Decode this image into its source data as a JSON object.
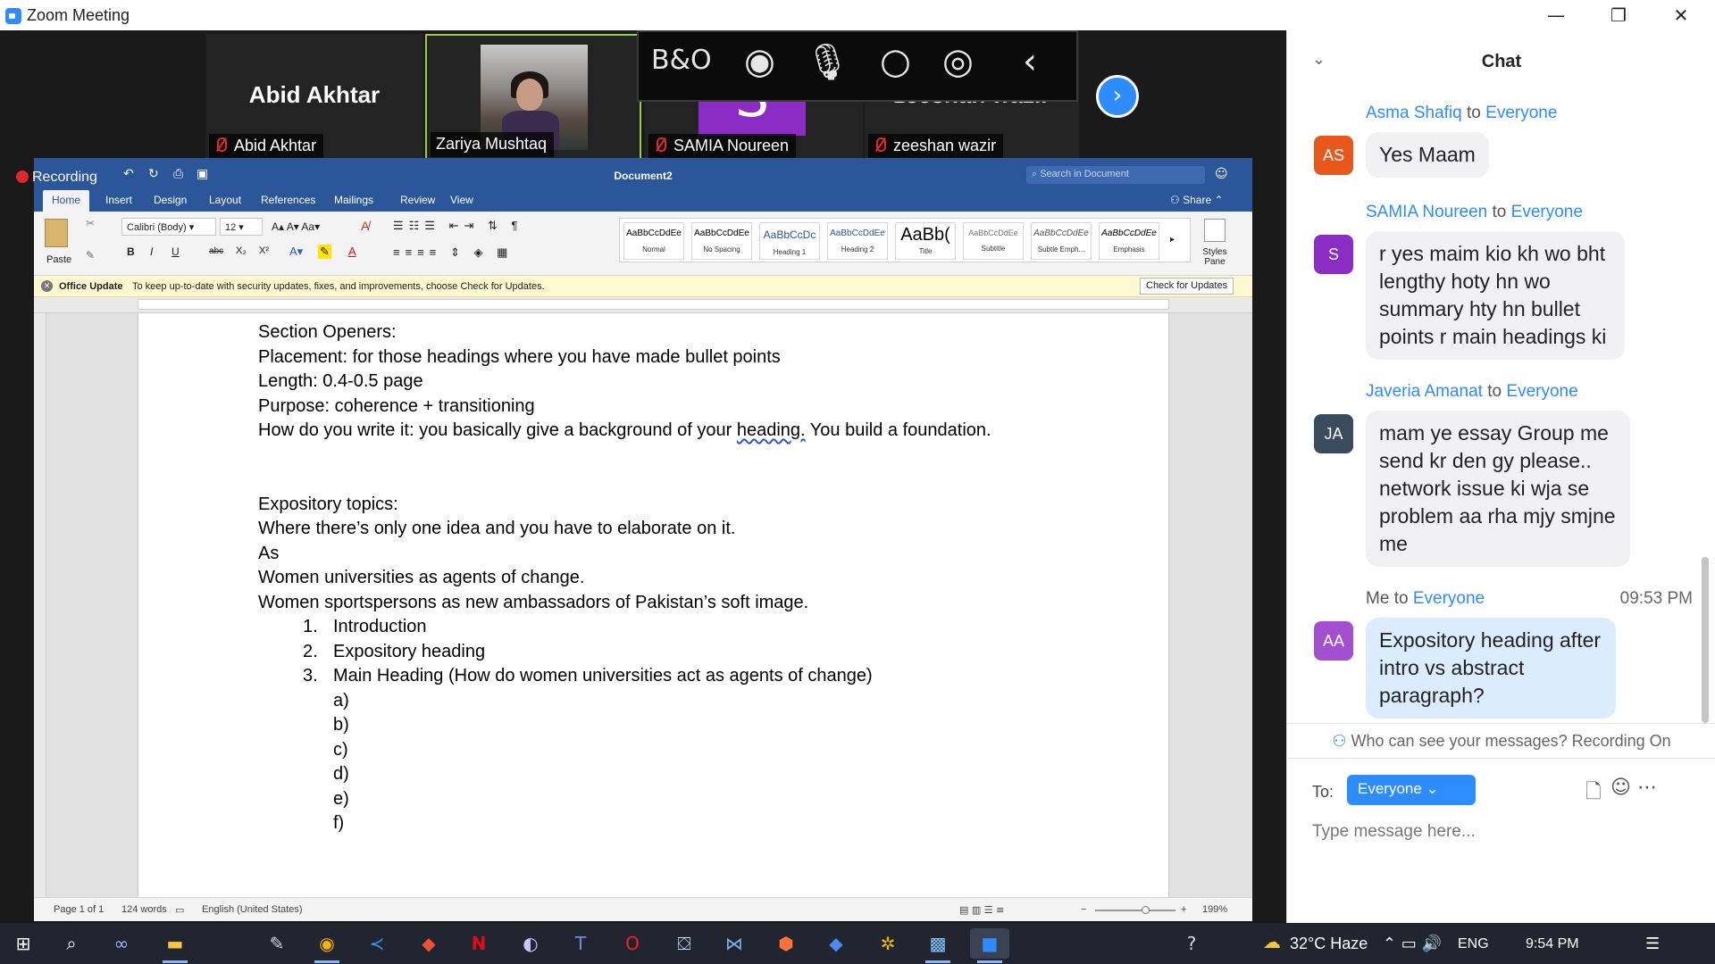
{
  "window": {
    "title": "Zoom Meeting",
    "minimize_icon": "—",
    "restore_icon": "❐",
    "close_icon": "✕"
  },
  "gallery": [
    {
      "display_name": "Abid Akhtar",
      "nameplate": "Abid Akhtar",
      "muted": true
    },
    {
      "nameplate": "Zariya Mushtaq",
      "video": true,
      "active_speaker": true
    },
    {
      "avatar_letter": "S",
      "nameplate": "SAMIA Noureen",
      "muted": true
    },
    {
      "display_name": "zeeshan wazir",
      "nameplate": "zeeshan wazir",
      "muted": true
    }
  ],
  "overlay": {
    "logo": "B&O",
    "icons": [
      "record-icon",
      "mic-icon",
      "circle-icon",
      "mic-active-icon",
      "back-icon"
    ]
  },
  "recording": {
    "label": "Recording"
  },
  "word": {
    "doc_title": "Document2",
    "search_placeholder": "Search in Document",
    "tabs": [
      "Home",
      "Insert",
      "Design",
      "Layout",
      "References",
      "Mailings",
      "Review",
      "View"
    ],
    "active_tab": "Home",
    "share_label": "Share",
    "ribbon": {
      "paste_label": "Paste",
      "font_name": "Calibri (Body)",
      "font_size": "12",
      "bold": "B",
      "italic": "I",
      "underline": "U",
      "strike": "abc",
      "subscript": "X₂",
      "superscript": "X²",
      "styles": [
        {
          "preview": "AaBbCcDdEe",
          "label": "Normal"
        },
        {
          "preview": "AaBbCcDdEe",
          "label": "No Spacing"
        },
        {
          "preview": "AaBbCcDc",
          "label": "Heading 1"
        },
        {
          "preview": "AaBbCcDdEe",
          "label": "Heading 2"
        },
        {
          "preview": "AaBb(",
          "label": "Title"
        },
        {
          "preview": "AaBbCcDdEe",
          "label": "Subtitle"
        },
        {
          "preview": "AaBbCcDdEe",
          "label": "Subtle Emph..."
        },
        {
          "preview": "AaBbCcDdEe",
          "label": "Emphasis"
        }
      ],
      "styles_pane": "Styles Pane"
    },
    "update_bar": {
      "title": "Office Update",
      "message": "To keep up-to-date with security updates, fixes, and improvements, choose Check for Updates.",
      "button": "Check for Updates"
    },
    "document": {
      "lines": [
        "Section Openers:",
        "Placement: for those headings where you have made bullet points",
        "Length: 0.4-0.5 page",
        "Purpose: coherence + transitioning"
      ],
      "line5_pre": "How do you write it: you basically give a background of your ",
      "line5_underlined": "heading.",
      "line5_post": " You build a foundation.",
      "lines2": [
        "Expository topics:",
        "Where there’s only one idea and you have to elaborate on it.",
        "As",
        "Women universities as agents of change.",
        "Women sportspersons as new ambassadors of Pakistan’s soft image."
      ],
      "numbered": [
        {
          "num": "1.",
          "text": "Introduction"
        },
        {
          "num": "2.",
          "text": "Expository heading"
        },
        {
          "num": "3.",
          "text": "Main Heading (How do women universities act as agents of change)"
        }
      ],
      "sub_items": [
        "a)",
        "b)",
        "c)",
        "d)",
        "e)",
        "f)"
      ]
    },
    "status": {
      "page": "Page 1 of 1",
      "words": "124 words",
      "language": "English (United States)",
      "zoom": "199%",
      "zoom_fraction": 0.62
    }
  },
  "chat": {
    "title": "Chat",
    "messages": [
      {
        "from": "Asma Shafiq",
        "to_word": "to",
        "to": "Everyone",
        "initials": "AS",
        "color": "#e8581c",
        "text": "Yes Maam"
      },
      {
        "from": "SAMIA Noureen",
        "to_word": "to",
        "to": "Everyone",
        "initials": "S",
        "color": "#8b2cc4",
        "text": "r yes maim kio kh wo bht lengthy hoty hn wo summary hty hn bullet points r main headings ki"
      },
      {
        "from": "Javeria Amanat",
        "to_word": "to",
        "to": "Everyone",
        "initials": "JA",
        "color": "#3b4b5e",
        "text": "mam ye essay Group me send kr den gy please.. network issue ki wja se problem aa rha mjy smjne me"
      },
      {
        "from": "Me",
        "to_word": "to",
        "to": "Everyone",
        "initials": "AA",
        "color": "#a24fd0",
        "time": "09:53 PM",
        "text": "Expository heading after intro vs abstract paragraph?"
      }
    ],
    "privacy_note": "Who can see your messages? Recording On",
    "to_label": "To:",
    "to_value": "Everyone",
    "input_placeholder": "Type message here..."
  },
  "taskbar": {
    "weather": "32°C  Haze",
    "language": "ENG",
    "time": "9:54 PM"
  },
  "colors": {
    "zoom_blue": "#2d8cff",
    "word_blue": "#2b579a",
    "muted_red": "#e02828",
    "active_border": "#9fcc3e"
  }
}
